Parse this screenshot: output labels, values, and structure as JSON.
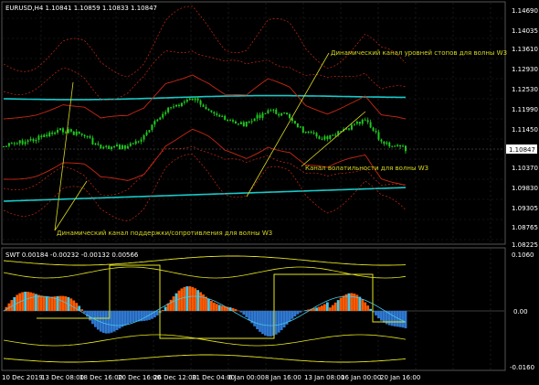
{
  "main_panel": {
    "symbol_info": "EURUSD,H4  1.10841 1.10859 1.10833 1.10847",
    "current_price": "1.10847",
    "price_ticks": [
      "1.14690",
      "1.14035",
      "1.13610",
      "1.12930",
      "1.12530",
      "1.11990",
      "1.11450",
      "1.10910",
      "1.10370",
      "1.09830",
      "1.09305",
      "1.08765",
      "1.08225"
    ],
    "annotations": {
      "levels_channel": "Динамический канал уровней стопов для волны W3",
      "volatility_channel": "Канал волатильности для волны W3",
      "support_channel": "Динамический канал поддержки/сопротивления для волны W3"
    }
  },
  "sub_panel": {
    "indicator_label": "SWT 0.00184 -0.00232 -0.00132 0.00566",
    "ticks": [
      "0.1060",
      "0.00",
      "-0.0160"
    ]
  },
  "time_axis": {
    "labels": [
      "10 Dec 2019",
      "13 Dec 08:00",
      "18 Dec 16:00",
      "20 Dec 16:00",
      "26 Dec 12:00",
      "31 Dec 04:00",
      "6 Jan 00:00",
      "8 Jan 16:00",
      "13 Jan 08:00",
      "16 Jan 00:00",
      "20 Jan 16:00"
    ]
  },
  "colors": {
    "background": "#000000",
    "grid": "#2a2a2a",
    "candles": "#1fc81f",
    "channel_cyan": "#19c8c8",
    "channel_red": "#c82814",
    "channel_dotted": "#c82814",
    "annotation": "#d8d820",
    "histo_orange": "#ff5a00",
    "histo_blue": "#2f78d2",
    "histo_cyan": "#46c8e6",
    "signal_yellow": "#e6e61e"
  }
}
